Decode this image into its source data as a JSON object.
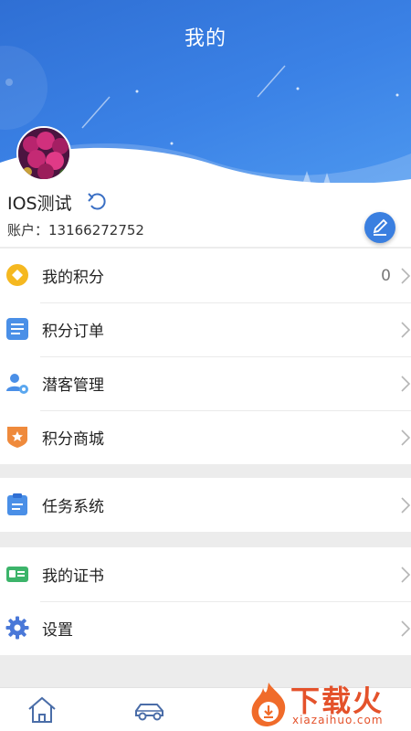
{
  "header": {
    "title": "我的"
  },
  "profile": {
    "username": "IOS测试",
    "account": "账户：13166272752"
  },
  "menu": {
    "group1": [
      {
        "label": "我的积分",
        "value": "0",
        "icon": "diamond-coin-icon"
      },
      {
        "label": "积分订单",
        "icon": "order-list-icon"
      },
      {
        "label": "潜客管理",
        "icon": "user-gear-icon"
      },
      {
        "label": "积分商城",
        "icon": "star-badge-icon"
      }
    ],
    "group2": [
      {
        "label": "任务系统",
        "icon": "clipboard-icon"
      }
    ],
    "group3": [
      {
        "label": "我的证书",
        "icon": "id-card-icon"
      },
      {
        "label": "设置",
        "icon": "settings-gear-icon"
      }
    ]
  },
  "tabbar": {
    "tabs": [
      "home-icon",
      "car-icon"
    ]
  },
  "watermark": {
    "text": "下载火",
    "sub": "xiazaihuo.com"
  },
  "colors": {
    "accent": "#3a7fe0",
    "header": "#3b82e6",
    "orange": "#ef8a3c",
    "yellow": "#f5b820",
    "green": "#3cb46a"
  }
}
